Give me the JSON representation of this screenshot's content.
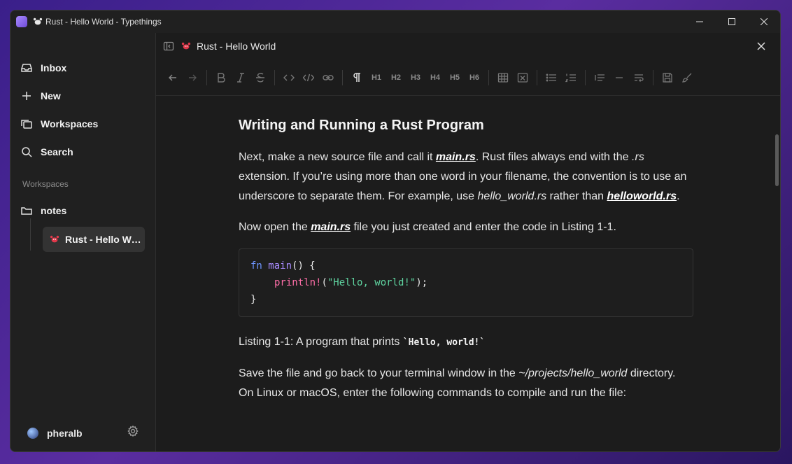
{
  "window": {
    "title": "Rust - Hello World - Typethings"
  },
  "sidebar": {
    "nav": [
      {
        "label": "Inbox",
        "icon": "inbox-icon"
      },
      {
        "label": "New",
        "icon": "plus-icon"
      },
      {
        "label": "Workspaces",
        "icon": "workspaces-icon"
      },
      {
        "label": "Search",
        "icon": "search-icon"
      }
    ],
    "section_label": "Workspaces",
    "workspace": {
      "label": "notes",
      "icon": "folder-icon"
    },
    "active_doc": {
      "label": "Rust - Hello World",
      "icon": "crab-icon"
    },
    "user": {
      "name": "pheralb"
    }
  },
  "editor": {
    "doc_title": "Rust - Hello World",
    "toolbar": {
      "headings": [
        "H1",
        "H2",
        "H3",
        "H4",
        "H5",
        "H6"
      ]
    },
    "content": {
      "heading": "Writing and Running a Rust Program",
      "p1": {
        "a": "Next, make a new source file and call it ",
        "link1": "main.rs",
        "b": ". Rust files always end with the ",
        "ext": ".rs",
        "c": " extension. If you’re using more than one word in your filename, the convention is to use an underscore to separate them. For example, use ",
        "ex1": "hello_world.rs",
        "d": " rather than ",
        "link2": "helloworld.rs",
        "e": "."
      },
      "p2": {
        "a": "Now open the ",
        "link": "main.rs",
        "b": " file you just created and enter the code in Listing 1-1."
      },
      "code": {
        "line1_kw": "fn",
        "line1_fn": "main",
        "line1_rest": "() {",
        "line2_mac": "println!",
        "line2_open": "(",
        "line2_str": "\"Hello, world!\"",
        "line2_close": ");",
        "line3": "}"
      },
      "caption": {
        "a": "Listing 1-1: A program that prints ",
        "code": "`Hello, world!`"
      },
      "p3": {
        "a": "Save the file and go back to your terminal window in the ",
        "path": "~/projects/hello_world",
        "b": " directory. On Linux or macOS, enter the following commands to compile and run the file:"
      }
    }
  }
}
